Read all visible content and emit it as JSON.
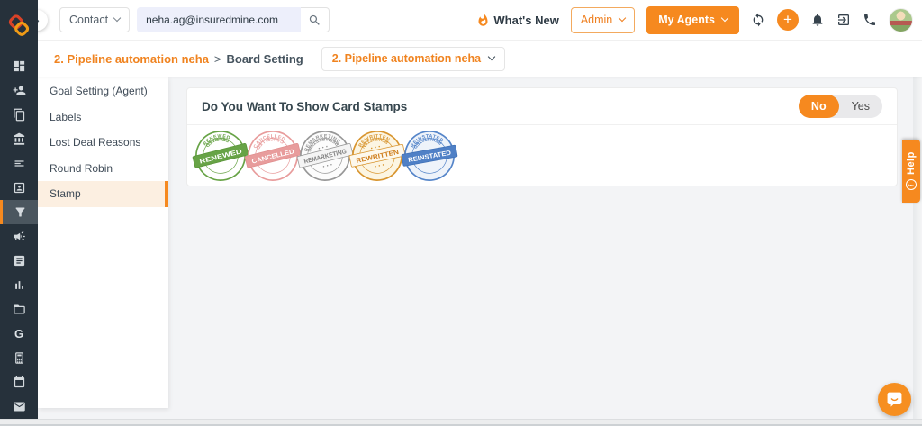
{
  "colors": {
    "accent": "#f6891f",
    "sidebar_dark": "#26313b"
  },
  "topbar": {
    "contact_label": "Contact",
    "search_value": "neha.ag@insuredmine.com",
    "whats_new_label": "What's New",
    "admin_label": "Admin",
    "my_agents_label": "My Agents",
    "icons": [
      "flame-icon",
      "refresh-icon",
      "add-icon",
      "bell-icon",
      "logout-icon",
      "phone-icon",
      "avatar"
    ],
    "plus_glyph": "+",
    "collapse_glyph": "›"
  },
  "breadcrumb": {
    "board_name": "2. Pipeline automation neha",
    "separator": ">",
    "page_label": "Board Setting",
    "selector_label": "2. Pipeline automation neha"
  },
  "sidebar": {
    "icons": [
      "dashboard-icon",
      "contacts-icon",
      "copy-icon",
      "bank-icon",
      "list-icon",
      "contact-card-icon",
      "pipeline-funnel-icon",
      "campaign-icon",
      "notebook-icon",
      "analytics-icon",
      "folder-icon",
      "google-icon",
      "calculator-icon",
      "calendar-icon",
      "mail-icon"
    ],
    "selected_icon": "pipeline-funnel-icon",
    "google_glyph": "G"
  },
  "settings_menu": {
    "items": [
      "Goal Setting (Agent)",
      "Labels",
      "Lost Deal Reasons",
      "Round Robin",
      "Stamp"
    ],
    "selected": "Stamp"
  },
  "main": {
    "card_title": "Do You Want To Show Card Stamps",
    "toggle": {
      "options": [
        "No",
        "Yes"
      ],
      "selected": "No"
    },
    "stamps": [
      {
        "label": "RENEWED",
        "ring": "#67a346",
        "fill": "#ffffff",
        "banner_fill": "#67a346",
        "banner_stroke": "#5a9539",
        "banner_text": "#ffffff",
        "dots": false,
        "rotate": -14
      },
      {
        "label": "CANCELLED",
        "ring": "#e89c9c",
        "fill": "#ffffff",
        "banner_fill": "#e89c9c",
        "banner_stroke": "#df8e8e",
        "banner_text": "#ffffff",
        "dots": false,
        "rotate": -14
      },
      {
        "label": "REMARKETING",
        "ring": "#979797",
        "fill": "#fcfcfc",
        "banner_fill": "#f4f4f4",
        "banner_stroke": "#979797",
        "banner_text": "#7f7f7f",
        "dots": true,
        "rotate": -14
      },
      {
        "label": "REWRITTEN",
        "ring": "#d8952f",
        "fill": "#fcf5e2",
        "banner_fill": "#fdf8ec",
        "banner_stroke": "#d8952f",
        "banner_text": "#cf7e1d",
        "dots": true,
        "rotate": -12
      },
      {
        "label": "REINSTATED",
        "ring": "#5585c9",
        "fill": "#eef3fa",
        "banner_fill": "#4f80c6",
        "banner_stroke": "#3f70b6",
        "banner_text": "#ffffff",
        "dots": false,
        "rotate": -10
      }
    ]
  },
  "help": {
    "label": "Help",
    "info_glyph": "i"
  }
}
